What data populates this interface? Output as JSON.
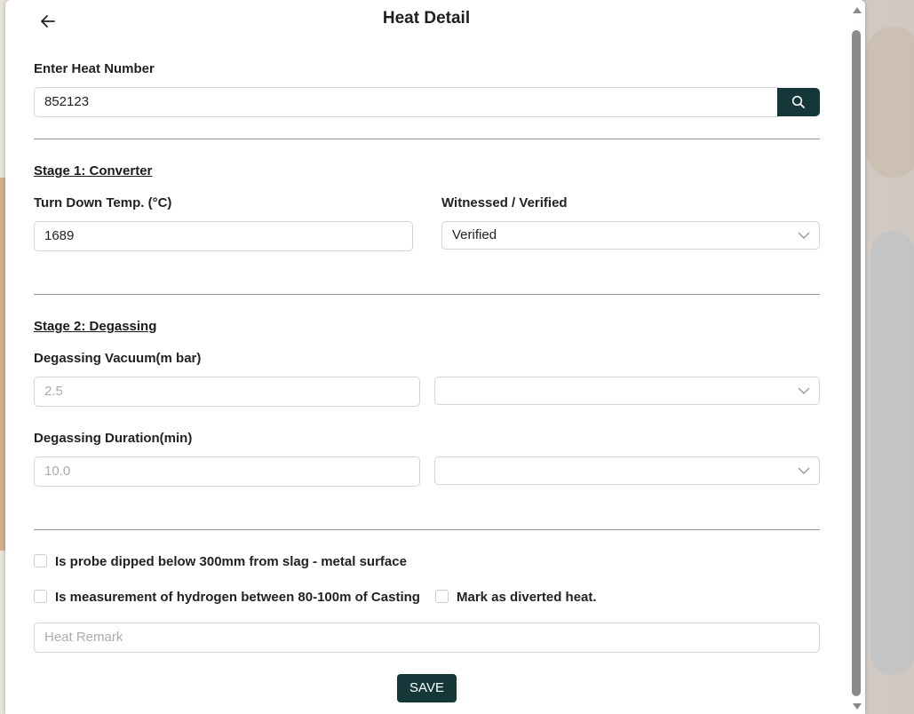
{
  "header": {
    "title": "Heat Detail",
    "back_icon": "arrow-left-icon"
  },
  "heat": {
    "label": "Enter Heat Number",
    "value": "852123",
    "search_icon": "search-icon"
  },
  "stage1": {
    "title": "Stage 1: Converter",
    "temp_label": "Turn Down Temp. (°C)",
    "temp_value": "1689",
    "witness_label": "Witnessed / Verified",
    "witness_value": "Verified"
  },
  "stage2": {
    "title": "Stage 2: Degassing",
    "vacuum_label": "Degassing Vacuum(m bar)",
    "vacuum_value": "2.5",
    "vacuum_select_value": "",
    "duration_label": "Degassing Duration(min)",
    "duration_value": "10.0",
    "duration_select_value": ""
  },
  "checks": {
    "probe_label": "Is probe dipped below 300mm from slag - metal surface",
    "hydrogen_label": "Is measurement of hydrogen between 80-100m of Casting",
    "diverted_label": "Mark as diverted heat.",
    "probe_checked": false,
    "hydrogen_checked": false,
    "diverted_checked": false
  },
  "remark": {
    "placeholder": "Heat Remark",
    "value": ""
  },
  "actions": {
    "save_label": "SAVE"
  },
  "colors": {
    "primary": "#16373a",
    "border": "#cfd4d8",
    "divider": "#9a9a9a"
  }
}
